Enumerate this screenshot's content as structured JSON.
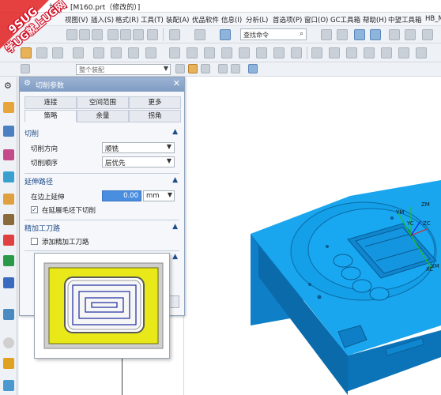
{
  "window": {
    "title": "加工 - [M160.prt（修改的）]"
  },
  "watermark": {
    "line1": "9SUG",
    "line2": "学UG就上UG网"
  },
  "menubar": {
    "items": [
      "视图(V)",
      "插入(S)",
      "格式(R)",
      "工具(T)",
      "装配(A)",
      "优品软件",
      "信息(I)",
      "分析(L)",
      "首选项(P)",
      "窗口(O)",
      "GC工具箱",
      "帮助(H)",
      "中望工具箱",
      "HB_M"
    ]
  },
  "toolbar": {
    "search_placeholder": "查找命令",
    "filter_label": "整个装配"
  },
  "dialog": {
    "title": "切削参数",
    "tabs_row1": [
      "连接",
      "空间范围",
      "更多"
    ],
    "tabs_row2": [
      "策略",
      "余量",
      "拐角"
    ],
    "active_tab": "策略",
    "section_cut": {
      "title": "切削",
      "direction_label": "切削方向",
      "direction_value": "顺铣",
      "order_label": "切削顺序",
      "order_value": "层优先"
    },
    "section_extend": {
      "title": "延伸路径",
      "extend_label": "在边上延伸",
      "extend_value": "0.00",
      "unit_value": "mm",
      "checkbox_label": "在延展毛坯下切削",
      "checkbox_checked": true
    },
    "section_finish": {
      "title": "精加工刀路",
      "checkbox_label": "添加精加工刀路",
      "checkbox_checked": false
    }
  },
  "viewport": {
    "axis_labels": [
      "ZM",
      "YM",
      "XM",
      "ZC",
      "YC",
      "XC"
    ],
    "part_color": "#1aa8f0"
  },
  "colors": {
    "accent": "#4a8ee0",
    "dialog_header": "#8aa5c9",
    "preview_fill": "#e9e91a"
  }
}
